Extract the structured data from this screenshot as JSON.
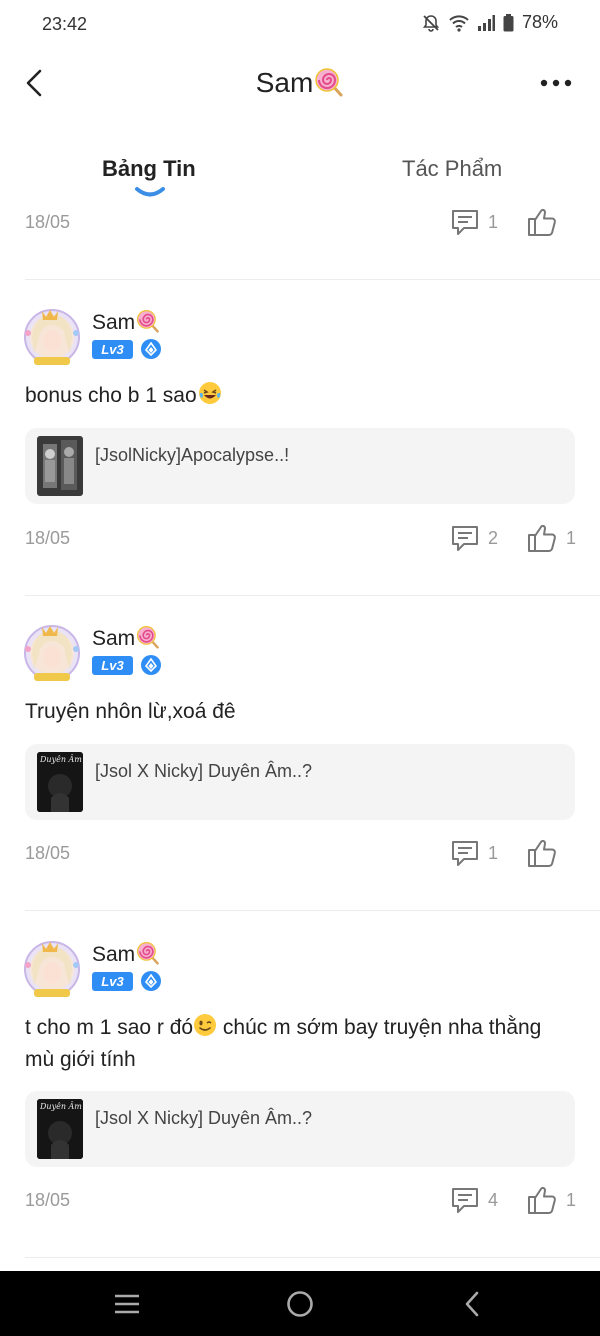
{
  "status_bar": {
    "time": "23:42",
    "battery": "78%",
    "icons": [
      "bell-off-icon",
      "wifi-icon",
      "signal-icon",
      "battery-icon"
    ]
  },
  "header": {
    "title": "Sam",
    "title_emoji": "lollipop-icon",
    "back_icon": "chevron-left-icon",
    "more_icon": "more-horizontal-icon"
  },
  "tabs": [
    {
      "label": "Bảng Tin",
      "active": true
    },
    {
      "label": "Tác Phẩm",
      "active": false
    }
  ],
  "top_meta": {
    "date": "18/05",
    "comments": "1",
    "likes": ""
  },
  "posts": [
    {
      "author": "Sam",
      "level": "Lv3",
      "text": "bonus cho b 1 sao",
      "text_emoji": "laughing-tears-emoji",
      "story": "[JsolNicky]Apocalypse..!",
      "date": "18/05",
      "comments": "2",
      "likes": "1"
    },
    {
      "author": "Sam",
      "level": "Lv3",
      "text": "Truyện nhôn lừ,xoá đê",
      "story": "[Jsol X Nicky] Duyên Âm..?",
      "thumb_text": "Duyên Âm",
      "date": "18/05",
      "comments": "1",
      "likes": ""
    },
    {
      "author": "Sam",
      "level": "Lv3",
      "text_before": "t cho m 1 sao r đó",
      "text_emoji": "winking-emoji",
      "text_after": " chúc m sớm bay truyện nha thằng mù giới tính",
      "story": "[Jsol X Nicky] Duyên Âm..?",
      "thumb_text": "Duyên Âm",
      "date": "18/05",
      "comments": "4",
      "likes": "1"
    }
  ],
  "nav_bar": {
    "buttons": [
      "recent-apps-icon",
      "home-icon",
      "back-icon"
    ]
  },
  "colors": {
    "accent": "#2f8ef5",
    "tab_indicator": "#3a8ee6",
    "muted_text": "#9a9a9a",
    "card_bg": "#f4f4f4"
  }
}
